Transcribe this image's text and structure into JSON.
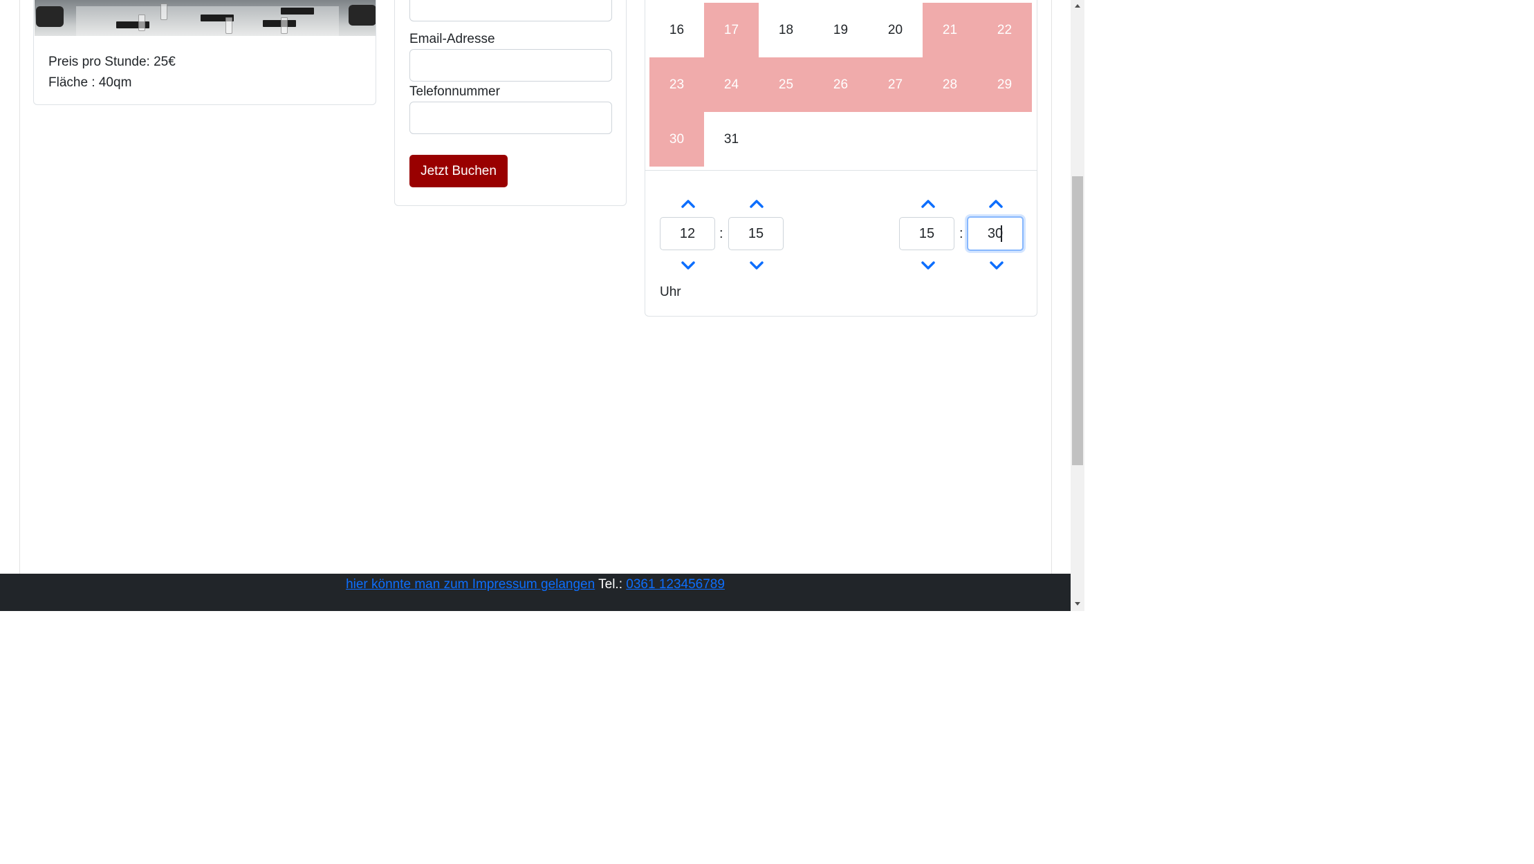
{
  "room": {
    "price": "Preis pro Stunde: 25€",
    "area": "Fläche : 40qm"
  },
  "form": {
    "email_label": "Email-Adresse",
    "phone_label": "Telefonnummer",
    "book_button": "Jetzt Buchen"
  },
  "calendar": {
    "row1": [
      "16",
      "17",
      "18",
      "19",
      "20",
      "21",
      "22"
    ],
    "row2": [
      "23",
      "24",
      "25",
      "26",
      "27",
      "28",
      "29"
    ],
    "row3": [
      "30",
      "31"
    ],
    "booked_days": [
      "17",
      "21",
      "22",
      "23",
      "24",
      "25",
      "26",
      "27",
      "28",
      "29",
      "30"
    ],
    "booked_color": "#f0abab"
  },
  "time": {
    "start_hour": "12",
    "start_minute": "15",
    "end_hour": "15",
    "end_minute": "30",
    "separator": ":",
    "unit_label": "Uhr",
    "arrow_color": "#0d6efd",
    "arrow_icons": [
      "chevron-up-icon",
      "chevron-down-icon"
    ]
  },
  "footer": {
    "impressum_link": "hier könnte man zum Impressum gelangen",
    "tel_label": "Tel.:",
    "phone_link": "0361 123456789",
    "background": "#212529"
  },
  "colors": {
    "primary_button": "#990000",
    "link": "#0d6efd"
  }
}
